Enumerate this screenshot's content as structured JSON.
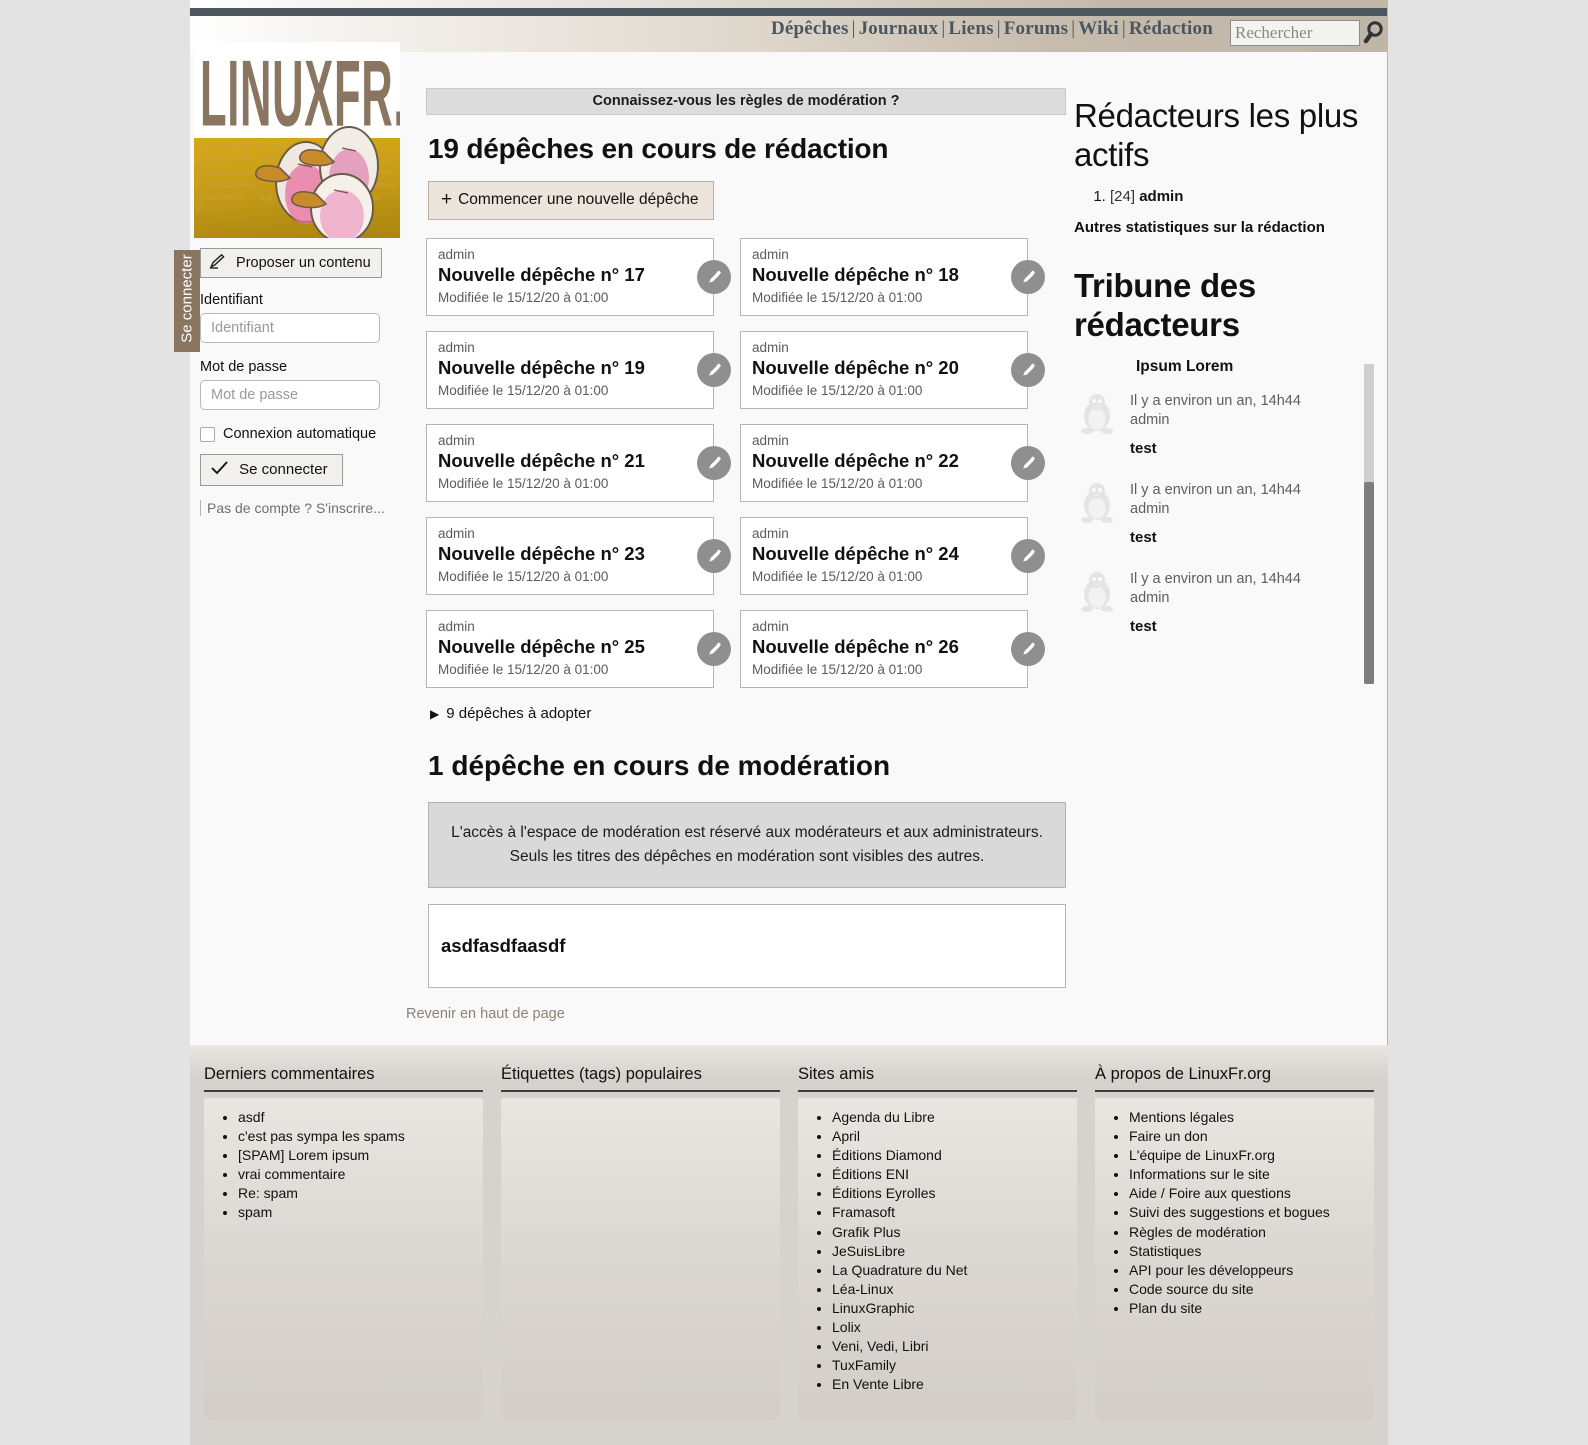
{
  "nav": {
    "items": [
      "Dépêches",
      "Journaux",
      "Liens",
      "Forums",
      "Wiki",
      "Rédaction"
    ],
    "separator": "|",
    "search_placeholder": "Rechercher",
    "search_value": "",
    "search_icon": "magnifier-icon"
  },
  "logo": {
    "wordmark": "LINUXFR.ORG",
    "license_text": "U GENERAL PUBLIC LICENSE ... Free Software Foundation, Inc. 02111-1307 copies of this license ... licenses for most ... change it. By contrast ... rantee your freedom ... ware Foundation ... ing it.(Some o... ny General P..."
  },
  "sidetab": {
    "label": "Se connecter"
  },
  "sidebar": {
    "propose_button": "Proposer un contenu",
    "propose_icon": "pencil-icon",
    "login_label": "Identifiant",
    "login_placeholder": "Identifiant",
    "login_value": "",
    "password_label": "Mot de passe",
    "password_placeholder": "Mot de passe",
    "password_value": "",
    "autoconnect_label": "Connexion automatique",
    "autoconnect_checked": false,
    "connect_button": "Se connecter",
    "connect_icon": "check-icon",
    "signup_link": "Pas de compte ? S'inscrire..."
  },
  "main": {
    "banner": "Connaissez-vous les règles de modération ?",
    "redaction_heading": "19 dépêches en cours de rédaction",
    "new_depeche_button": "Commencer une nouvelle dépêche",
    "new_depeche_icon": "plus-icon",
    "cards": [
      {
        "author": "admin",
        "title": "Nouvelle dépêche n° 17",
        "date": "Modifiée le 15/12/20 à 01:00",
        "edit_icon": "pencil-icon"
      },
      {
        "author": "admin",
        "title": "Nouvelle dépêche n° 18",
        "date": "Modifiée le 15/12/20 à 01:00",
        "edit_icon": "pencil-icon"
      },
      {
        "author": "admin",
        "title": "Nouvelle dépêche n° 19",
        "date": "Modifiée le 15/12/20 à 01:00",
        "edit_icon": "pencil-icon"
      },
      {
        "author": "admin",
        "title": "Nouvelle dépêche n° 20",
        "date": "Modifiée le 15/12/20 à 01:00",
        "edit_icon": "pencil-icon"
      },
      {
        "author": "admin",
        "title": "Nouvelle dépêche n° 21",
        "date": "Modifiée le 15/12/20 à 01:00",
        "edit_icon": "pencil-icon"
      },
      {
        "author": "admin",
        "title": "Nouvelle dépêche n° 22",
        "date": "Modifiée le 15/12/20 à 01:00",
        "edit_icon": "pencil-icon"
      },
      {
        "author": "admin",
        "title": "Nouvelle dépêche n° 23",
        "date": "Modifiée le 15/12/20 à 01:00",
        "edit_icon": "pencil-icon"
      },
      {
        "author": "admin",
        "title": "Nouvelle dépêche n° 24",
        "date": "Modifiée le 15/12/20 à 01:00",
        "edit_icon": "pencil-icon"
      },
      {
        "author": "admin",
        "title": "Nouvelle dépêche n° 25",
        "date": "Modifiée le 15/12/20 à 01:00",
        "edit_icon": "pencil-icon"
      },
      {
        "author": "admin",
        "title": "Nouvelle dépêche n° 26",
        "date": "Modifiée le 15/12/20 à 01:00",
        "edit_icon": "pencil-icon"
      }
    ],
    "adopt_toggle": "9 dépêches à adopter",
    "adopt_icon": "triangle-right-icon",
    "moderation_heading": "1 dépêche en cours de modération",
    "moderation_notice_line1": "L'accès à l'espace de modération est réservé aux modérateurs et aux administrateurs.",
    "moderation_notice_line2": "Seuls les titres des dépêches en modération sont visibles des autres.",
    "moderation_card_title": "asdfasdfaasdf",
    "back_to_top": "Revenir en haut de page"
  },
  "right": {
    "editors_heading": "Rédacteurs les plus actifs",
    "editors": [
      {
        "rank": "1.",
        "count": "[24]",
        "name": "admin"
      }
    ],
    "stats_link": "Autres statistiques sur la rédaction",
    "tribune_heading": "Tribune des rédacteurs",
    "tribune_title": "Ipsum Lorem",
    "tribune_posts": [
      {
        "meta": "Il y a environ un an, 14h44",
        "author": "admin",
        "message": "test",
        "avatar_icon": "penguin-avatar-icon"
      },
      {
        "meta": "Il y a environ un an, 14h44",
        "author": "admin",
        "message": "test",
        "avatar_icon": "penguin-avatar-icon"
      },
      {
        "meta": "Il y a environ un an, 14h44",
        "author": "admin",
        "message": "test",
        "avatar_icon": "penguin-avatar-icon"
      }
    ]
  },
  "footer": {
    "columns": [
      {
        "title": "Derniers commentaires",
        "items": [
          "asdf",
          "c'est pas sympa les spams",
          "[SPAM] Lorem ipsum",
          "vrai commentaire",
          "Re: spam",
          "spam"
        ]
      },
      {
        "title": "Étiquettes (tags) populaires",
        "items": []
      },
      {
        "title": "Sites amis",
        "items": [
          "Agenda du Libre",
          "April",
          "Éditions Diamond",
          "Éditions ENI",
          "Éditions Eyrolles",
          "Framasoft",
          "Grafik Plus",
          "JeSuisLibre",
          "La Quadrature du Net",
          "Léa-Linux",
          "LinuxGraphic",
          "Lolix",
          "Veni, Vedi, Libri",
          "TuxFamily",
          "En Vente Libre"
        ]
      },
      {
        "title": "À propos de LinuxFr.org",
        "items": [
          "Mentions légales",
          "Faire un don",
          "L'équipe de LinuxFr.org",
          "Informations sur le site",
          "Aide / Foire aux questions",
          "Suivi des suggestions et bogues",
          "Règles de modération",
          "Statistiques",
          "API pour les développeurs",
          "Code source du site",
          "Plan du site"
        ]
      }
    ]
  },
  "colors": {
    "nav_text": "#4c565e",
    "dark_bar": "#4c565e",
    "accent_brown": "#8a7560",
    "logo_gold": "#c59a16",
    "page_bg": "#f9f9f9",
    "outer_bg": "#e3e3e3"
  }
}
